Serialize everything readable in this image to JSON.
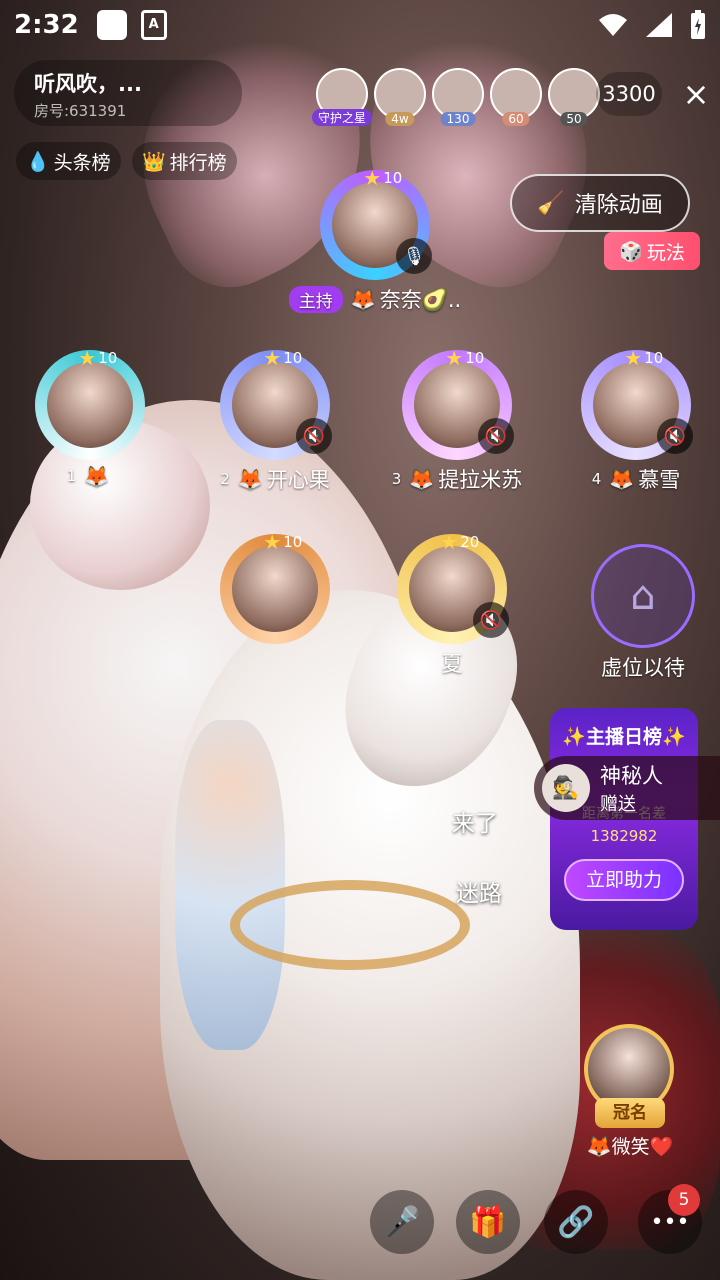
{
  "status_bar": {
    "time": "2:32",
    "app_icon": "A"
  },
  "room": {
    "title": "听风吹，...",
    "room_id": "房号:631391"
  },
  "audience": {
    "avatars": [
      {
        "tag": "守护之星",
        "tag_color": "#7b3bd6"
      },
      {
        "tag": "4w",
        "tag_color": "#c79a5a"
      },
      {
        "tag": "130",
        "tag_color": "#6e83c9"
      },
      {
        "tag": "60",
        "tag_color": "#d48c74"
      },
      {
        "tag": "50",
        "tag_color": "#555555"
      }
    ],
    "online_count": "3300",
    "close_icon": "×"
  },
  "pills": {
    "headline": "头条榜",
    "ranking": "排行榜"
  },
  "buttons": {
    "clear_animation": "清除动画",
    "gameplay": "玩法"
  },
  "host": {
    "level": "10",
    "tag": "主持",
    "name": "奈奈🥑.."
  },
  "seats": [
    {
      "num": "1",
      "level": "10",
      "name": "",
      "ring": "#38c9d6"
    },
    {
      "num": "2",
      "level": "10",
      "name": "开心果",
      "ring": "#7d8df5"
    },
    {
      "num": "3",
      "level": "10",
      "name": "提拉米苏",
      "ring": "#c278ff"
    },
    {
      "num": "4",
      "level": "10",
      "name": "慕雪",
      "ring": "#a48cff"
    },
    {
      "num": "",
      "level": "10",
      "name": "",
      "ring": "#e08a3c"
    },
    {
      "num": "",
      "level": "20",
      "name": "夏",
      "ring": "#f1c04a"
    },
    {
      "num": "",
      "level": "",
      "name": "虚位以待",
      "ring": "#9b6cff"
    }
  ],
  "daily_board": {
    "title": "✨主播日榜✨",
    "gap_label": "距离第一名差",
    "gap_value": "1382982",
    "help_button": "立即助力"
  },
  "gift_notice": {
    "name": "神秘人",
    "action": "赠送"
  },
  "chat": {
    "line1": "来了",
    "line2": "迷路"
  },
  "crowned_user": {
    "badge": "冠名",
    "name": "微笑❤️"
  },
  "bottom_bar": {
    "more_badge": "5"
  }
}
